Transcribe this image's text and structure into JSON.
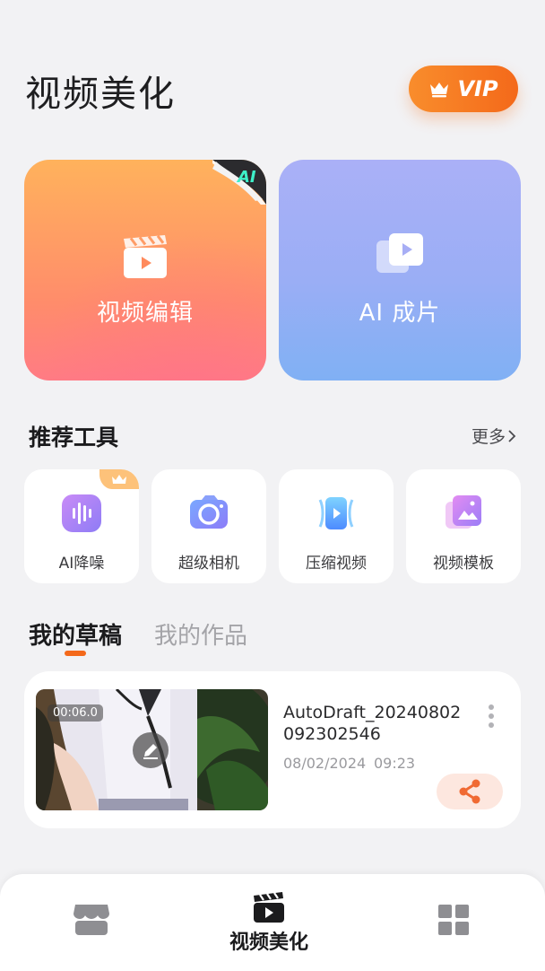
{
  "header": {
    "title": "视频美化",
    "vip_label": "VIP"
  },
  "feature_cards": [
    {
      "label": "视频编辑",
      "badge": "AI",
      "icon": "clapperboard-icon"
    },
    {
      "label": "AI 成片",
      "icon": "stacked-video-icon"
    }
  ],
  "tools_section": {
    "title": "推荐工具",
    "more_label": "更多"
  },
  "tools": [
    {
      "label": "AI降噪",
      "icon": "noise-reduction-icon",
      "premium": true
    },
    {
      "label": "超级相机",
      "icon": "camera-icon"
    },
    {
      "label": "压缩视频",
      "icon": "compress-video-icon"
    },
    {
      "label": "视频模板",
      "icon": "video-template-icon"
    }
  ],
  "tabs": [
    {
      "label": "我的草稿",
      "active": true
    },
    {
      "label": "我的作品",
      "active": false
    }
  ],
  "draft": {
    "duration": "00:06.0",
    "name": "AutoDraft_20240802092302546",
    "date": "08/02/2024",
    "time": "09:23"
  },
  "bottom_nav": {
    "items": [
      {
        "icon": "store-icon",
        "label": ""
      },
      {
        "icon": "video-beautify-icon",
        "label": "视频美化",
        "active": true
      },
      {
        "icon": "grid-apps-icon",
        "label": ""
      }
    ]
  },
  "colors": {
    "accent": "#F4691A",
    "card_edit_top": "#FFB25C",
    "card_ai_top": "#AAB0F7",
    "background": "#F2F2F4"
  }
}
